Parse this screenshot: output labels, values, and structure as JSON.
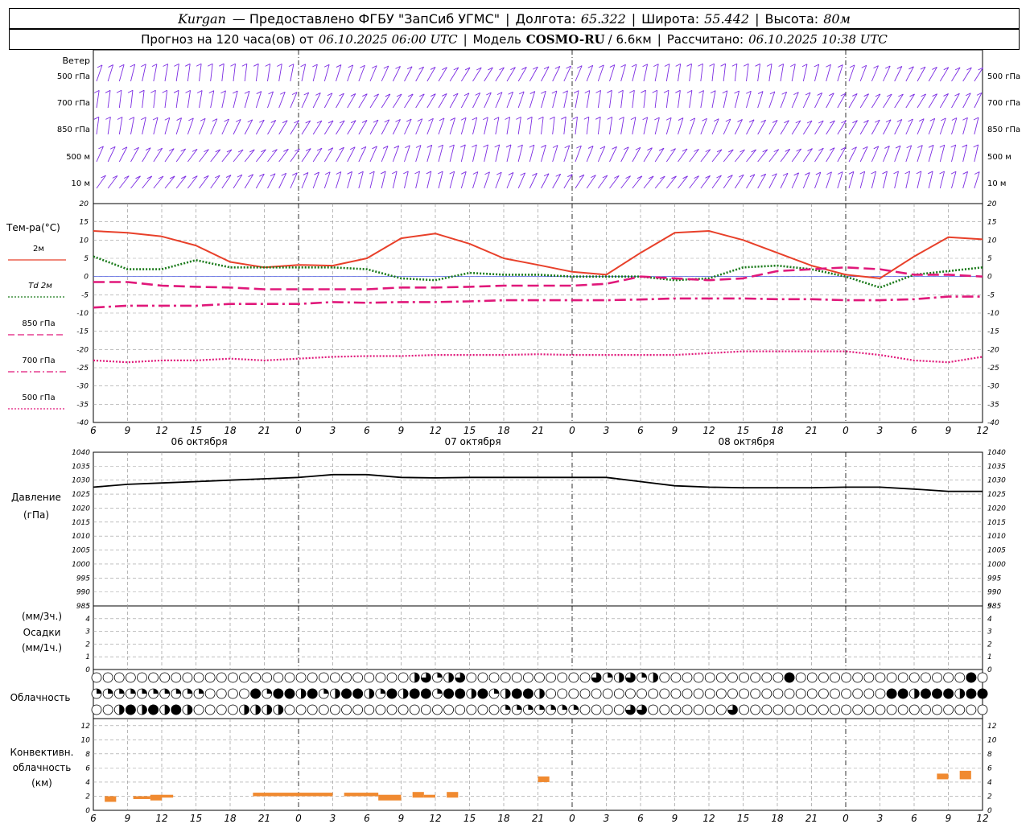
{
  "header": {
    "station": "Kurgan",
    "provider": "— Предоставлено ФГБУ \"ЗапСиб УГМС\"",
    "lon_label": "Долгота:",
    "lon_value": "65.322",
    "lat_label": "Широта:",
    "lat_value": "55.442",
    "alt_label": "Высота:",
    "alt_value": "80м",
    "forecast_label": "Прогноз на 120 часа(ов) от",
    "forecast_from": "06.10.2025 06:00 UTC",
    "model_label": "Модель",
    "model_name": "COSMO-RU",
    "model_res": "/ 6.6км",
    "calc_label": "Рассчитано:",
    "calc_time": "06.10.2025 10:38 UTC"
  },
  "chart_data": [
    {
      "type": "line",
      "title": "",
      "panel": "wind",
      "ylabel": "Ветер",
      "levels": [
        "500 гПа",
        "700 гПа",
        "850 гПа",
        "500 м",
        "10 м"
      ],
      "color": "#7b2be2"
    },
    {
      "type": "line",
      "panel": "temperature",
      "ylabel": "Тем-ра(°C)",
      "ylim": [
        -40,
        20
      ],
      "yticks": [
        20,
        15,
        10,
        5,
        0,
        -5,
        -10,
        -15,
        -20,
        -25,
        -30,
        -35,
        -40
      ],
      "x_hours": [
        6,
        9,
        12,
        15,
        18,
        21,
        24,
        27,
        30,
        33,
        36,
        39,
        42,
        45,
        48,
        51,
        54,
        57,
        60,
        63,
        66,
        69,
        72,
        75,
        78,
        81,
        84
      ],
      "x_tick_labels": [
        "6",
        "9",
        "12",
        "15",
        "18",
        "21",
        "0",
        "3",
        "6",
        "9",
        "12",
        "15",
        "18",
        "21",
        "0",
        "3",
        "6",
        "9",
        "12",
        "15",
        "18",
        "21",
        "0",
        "3",
        "6",
        "9",
        "12"
      ],
      "day_labels": [
        "06 октября",
        "07 октября",
        "08 октября"
      ],
      "series": [
        {
          "name": "2м",
          "color": "#e8402a",
          "dash": "solid",
          "values": [
            12.5,
            12,
            11,
            8.5,
            4,
            2.5,
            3.2,
            3,
            5,
            10.5,
            11.8,
            9,
            5,
            3.2,
            1.3,
            0.5,
            6.5,
            12,
            12.5,
            10,
            6.5,
            3,
            0.5,
            -0.5,
            5.5,
            10.8,
            10.2
          ]
        },
        {
          "name": "Td 2м",
          "color": "#1a7a1a",
          "dash": "dotted",
          "values": [
            5.5,
            2,
            2,
            4.5,
            2.5,
            2.5,
            2.5,
            2.5,
            2,
            -0.5,
            -1,
            1,
            0.5,
            0.5,
            0,
            0,
            0,
            -1,
            -0.5,
            2.5,
            3,
            2,
            0,
            -3,
            0.5,
            1.5,
            2.5
          ]
        },
        {
          "name": "850 гПа",
          "color": "#e0187a",
          "dash": "dash",
          "values": [
            -1.5,
            -1.5,
            -2.5,
            -2.8,
            -3,
            -3.5,
            -3.5,
            -3.5,
            -3.5,
            -3,
            -3,
            -2.8,
            -2.5,
            -2.5,
            -2.5,
            -2,
            0,
            -0.5,
            -1,
            -0.5,
            1.5,
            2,
            2.5,
            2,
            0.5,
            0.5,
            0
          ]
        },
        {
          "name": "700 гПа",
          "color": "#e0187a",
          "dash": "dashdot",
          "values": [
            -8.5,
            -8,
            -8,
            -8,
            -7.5,
            -7.5,
            -7.5,
            -7,
            -7.2,
            -7,
            -7,
            -6.8,
            -6.5,
            -6.5,
            -6.5,
            -6.5,
            -6.3,
            -6,
            -6,
            -6,
            -6.2,
            -6.2,
            -6.5,
            -6.5,
            -6.2,
            -5.5,
            -5.5
          ]
        },
        {
          "name": "500 гПа",
          "color": "#e0187a",
          "dash": "dotted",
          "values": [
            -23,
            -23.5,
            -23,
            -23,
            -22.5,
            -23,
            -22.5,
            -22,
            -21.8,
            -21.8,
            -21.5,
            -21.5,
            -21.5,
            -21.3,
            -21.5,
            -21.5,
            -21.5,
            -21.5,
            -21,
            -20.5,
            -20.5,
            -20.5,
            -20.5,
            -21.5,
            -23,
            -23.5,
            -22
          ]
        }
      ]
    },
    {
      "type": "line",
      "panel": "pressure",
      "ylabel": "Давление",
      "yunit": "(гПа)",
      "ylim": [
        985,
        1040
      ],
      "yticks": [
        1040,
        1035,
        1030,
        1025,
        1020,
        1015,
        1010,
        1005,
        1000,
        995,
        990,
        985
      ],
      "series": [
        {
          "name": "",
          "color": "#000000",
          "values": [
            1027.5,
            1028.5,
            1029,
            1029.5,
            1030,
            1030.5,
            1031,
            1032,
            1032,
            1031,
            1030.8,
            1031,
            1031,
            1031,
            1031,
            1031,
            1029.5,
            1028,
            1027.5,
            1027.3,
            1027.3,
            1027.3,
            1027.5,
            1027.5,
            1026.8,
            1026,
            1026
          ]
        }
      ]
    },
    {
      "type": "bar",
      "panel": "precipitation",
      "ylabel": "Осадки",
      "yunit_top": "(мм/3ч.)",
      "yunit_bottom": "(мм/1ч.)",
      "ylim": [
        0,
        5
      ],
      "yticks": [
        5,
        4,
        3,
        2,
        1,
        0
      ],
      "values": []
    },
    {
      "type": "table",
      "panel": "cloudiness",
      "ylabel": "Облачность",
      "rows": 3,
      "note": "cloud cover symbols per hour: 0 empty, 1 quarter, 2 half, 3 three-quarter, 4 full"
    },
    {
      "type": "bar",
      "panel": "convective",
      "ylabel_lines": [
        "Конвективн.",
        "облачность",
        "(км)"
      ],
      "ylim": [
        0,
        13
      ],
      "yticks": [
        12,
        10,
        8,
        6,
        4,
        2,
        0
      ],
      "color": "#f08a30",
      "bars": [
        {
          "x0": 7,
          "x1": 8,
          "y0": 1.2,
          "y1": 2
        },
        {
          "x0": 9.5,
          "x1": 11,
          "y0": 1.6,
          "y1": 2
        },
        {
          "x0": 11,
          "x1": 12,
          "y0": 1.4,
          "y1": 2.2
        },
        {
          "x0": 12,
          "x1": 13,
          "y0": 1.8,
          "y1": 2.2
        },
        {
          "x0": 20,
          "x1": 27,
          "y0": 2,
          "y1": 2.5
        },
        {
          "x0": 28,
          "x1": 31,
          "y0": 2,
          "y1": 2.5
        },
        {
          "x0": 31,
          "x1": 33,
          "y0": 1.4,
          "y1": 2.2
        },
        {
          "x0": 34,
          "x1": 35,
          "y0": 1.8,
          "y1": 2.6
        },
        {
          "x0": 35,
          "x1": 36,
          "y0": 1.8,
          "y1": 2.2
        },
        {
          "x0": 37,
          "x1": 38,
          "y0": 1.8,
          "y1": 2.6
        },
        {
          "x0": 45,
          "x1": 46,
          "y0": 4,
          "y1": 4.8
        },
        {
          "x0": 80,
          "x1": 81,
          "y0": 4.4,
          "y1": 5.2
        },
        {
          "x0": 82,
          "x1": 83,
          "y0": 4.4,
          "y1": 5.6
        }
      ]
    }
  ],
  "temp_legend": [
    "2м",
    "Td  2м",
    "850 гПа",
    "700 гПа",
    "500 гПа"
  ]
}
